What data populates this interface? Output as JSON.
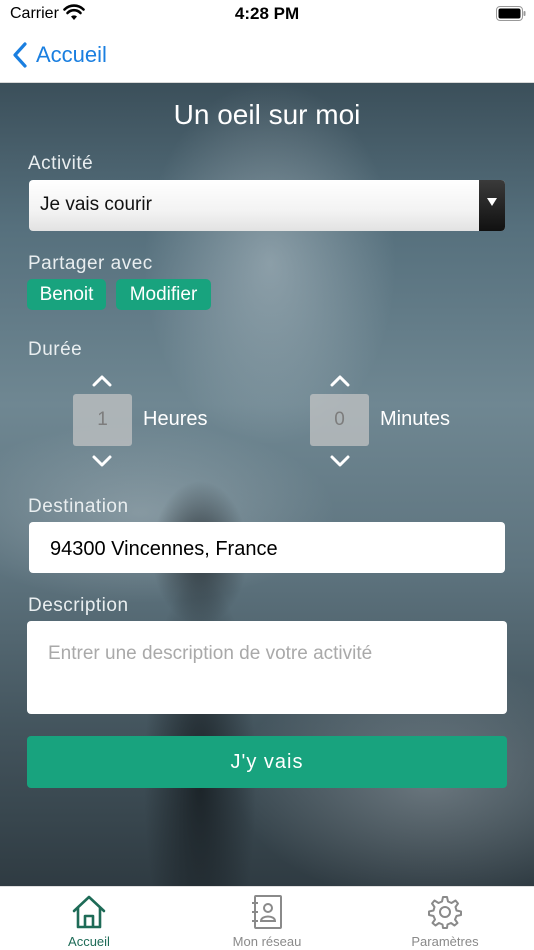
{
  "status_bar": {
    "carrier": "Carrier",
    "time": "4:28 PM"
  },
  "nav": {
    "back_label": "Accueil"
  },
  "page": {
    "title": "Un oeil sur moi"
  },
  "activity": {
    "label": "Activité",
    "selected": "Je vais courir"
  },
  "share": {
    "label": "Partager avec",
    "contact": "Benoit",
    "modify": "Modifier"
  },
  "duration": {
    "label": "Durée",
    "hours_value": "1",
    "hours_unit": "Heures",
    "minutes_value": "0",
    "minutes_unit": "Minutes"
  },
  "destination": {
    "label": "Destination",
    "value": "94300 Vincennes, France"
  },
  "description": {
    "label": "Description",
    "placeholder": "Entrer une description de votre activité"
  },
  "submit": {
    "label": "J'y vais"
  },
  "tabs": [
    {
      "label": "Accueil",
      "icon": "home-icon",
      "active": true
    },
    {
      "label": "Mon réseau",
      "icon": "contacts-icon",
      "active": false
    },
    {
      "label": "Paramètres",
      "icon": "gear-icon",
      "active": false
    }
  ],
  "colors": {
    "accent": "#18a37e",
    "link": "#1a7fe0",
    "inactive_tab": "#8a8a8a",
    "active_tab": "#1e6b57"
  }
}
